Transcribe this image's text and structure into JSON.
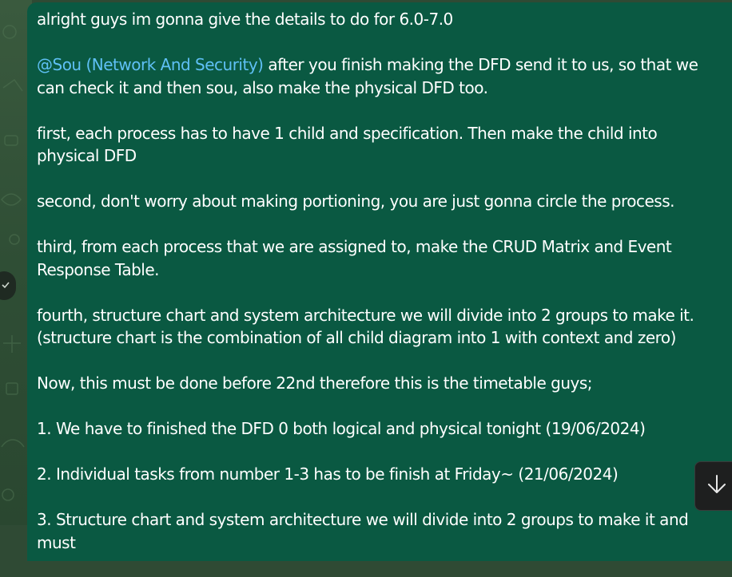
{
  "message": {
    "intro": "alright guys im gonna give the details to do for 6.0-7.0",
    "mention": "@Sou (Network And Security)",
    "mention_rest": " after you finish making the DFD send it to us, so that we can check it and then sou, also make the physical DFD too.",
    "first": "first, each process has to have 1 child and specification. Then make the child into physical DFD",
    "second": "second, don't worry about making portioning, you are just gonna circle the process.",
    "third": "third, from each process that we are assigned to, make the CRUD Matrix and Event Response Table.",
    "fourth": "fourth, structure chart and system architecture we will divide into 2 groups to make it. (structure chart is the combination of all child diagram into 1 with context and zero)",
    "now": "Now, this must be done before 22nd therefore this is the timetable guys;",
    "step1": "1. We have to finished the DFD 0 both logical and physical tonight (19/06/2024)",
    "step2": "2. Individual tasks from number 1-3 has to be finish at Friday~ (21/06/2024)",
    "step3": "3.  Structure chart and system architecture we will divide into 2 groups to make it and must"
  },
  "icons": {
    "scroll_down": "arrow-down-icon",
    "read_status": "check-icon"
  },
  "colors": {
    "bubble": "#0a5942",
    "mention": "#5fc0f5",
    "wallpaper": "#2f4a34"
  }
}
